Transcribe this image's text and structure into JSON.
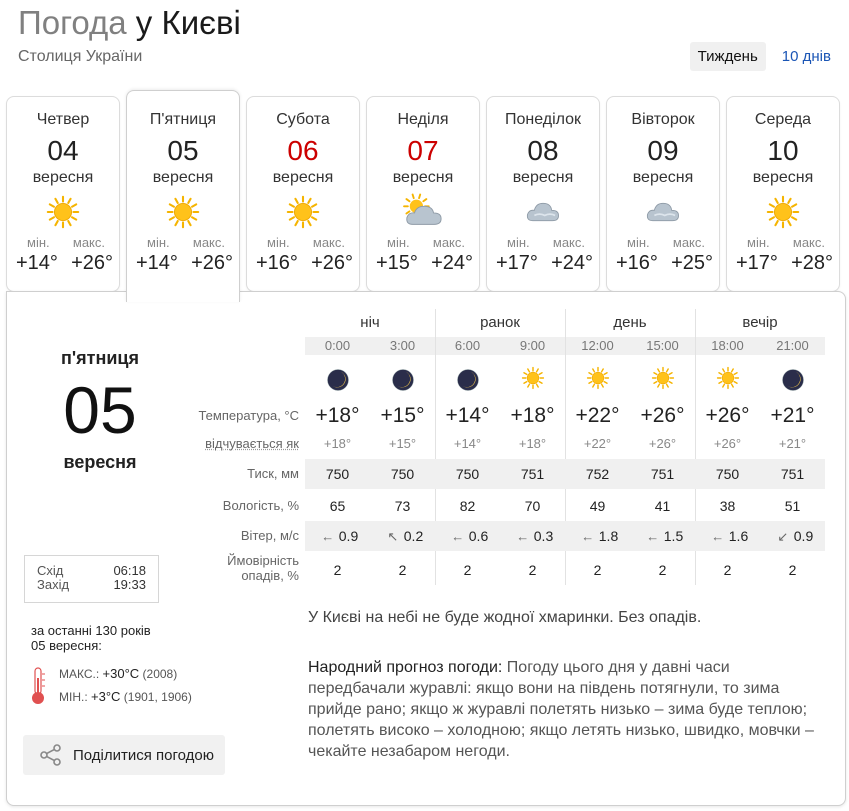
{
  "header": {
    "title_prefix": "Погода",
    "title_city": "у Києві",
    "subtitle": "Столиця України"
  },
  "period_switch": {
    "week": "Тиждень",
    "ten_days": "10 днів"
  },
  "labels": {
    "min": "мін.",
    "max": "макс."
  },
  "days": [
    {
      "name": "Четвер",
      "num": "04",
      "month": "вересня",
      "icon": "sun-icon",
      "min": "+14°",
      "max": "+26°",
      "weekend": false
    },
    {
      "name": "П'ятниця",
      "num": "05",
      "month": "вересня",
      "icon": "sun-icon",
      "min": "+14°",
      "max": "+26°",
      "weekend": false
    },
    {
      "name": "Субота",
      "num": "06",
      "month": "вересня",
      "icon": "sun-icon",
      "min": "+16°",
      "max": "+26°",
      "weekend": true
    },
    {
      "name": "Неділя",
      "num": "07",
      "month": "вересня",
      "icon": "sun-cloud-icon",
      "min": "+15°",
      "max": "+24°",
      "weekend": true
    },
    {
      "name": "Понеділок",
      "num": "08",
      "month": "вересня",
      "icon": "cloud-icon",
      "min": "+17°",
      "max": "+24°",
      "weekend": false
    },
    {
      "name": "Вівторок",
      "num": "09",
      "month": "вересня",
      "icon": "cloud-icon",
      "min": "+16°",
      "max": "+25°",
      "weekend": false
    },
    {
      "name": "Середа",
      "num": "10",
      "month": "вересня",
      "icon": "sun-icon",
      "min": "+17°",
      "max": "+28°",
      "weekend": false
    }
  ],
  "selected": {
    "day_name": "п'ятниця",
    "day_num": "05",
    "month": "вересня",
    "sunrise_label": "Схід",
    "sunrise": "06:18",
    "sunset_label": "Захід",
    "sunset": "19:33",
    "history_line1": "за останні 130 років",
    "history_line2": "05 вересня:",
    "max_label": "МАКС.:",
    "max_value": "+30°C",
    "max_years": "(2008)",
    "min_label": "МІН.:",
    "min_value": "+3°C",
    "min_years": "(1901, 1906)",
    "share": "Поділитися погодою"
  },
  "periods": [
    "ніч",
    "ранок",
    "день",
    "вечір"
  ],
  "row_labels": {
    "temperature": "Температура, °С",
    "feels": "відчувається як",
    "pressure": "Тиск, мм",
    "humidity": "Вологість, %",
    "wind": "Вітер, м/с",
    "precip": "Ймовірність опадів, %"
  },
  "hours": [
    {
      "time": "0:00",
      "icon": "moon-icon",
      "temp": "+18°",
      "feels": "+18°",
      "pressure": "750",
      "humidity": "65",
      "wind_dir": "←",
      "wind": "0.9",
      "precip": "2"
    },
    {
      "time": "3:00",
      "icon": "moon-icon",
      "temp": "+15°",
      "feels": "+15°",
      "pressure": "750",
      "humidity": "73",
      "wind_dir": "↖",
      "wind": "0.2",
      "precip": "2"
    },
    {
      "time": "6:00",
      "icon": "moon-icon",
      "temp": "+14°",
      "feels": "+14°",
      "pressure": "750",
      "humidity": "82",
      "wind_dir": "←",
      "wind": "0.6",
      "precip": "2"
    },
    {
      "time": "9:00",
      "icon": "sun-icon",
      "temp": "+18°",
      "feels": "+18°",
      "pressure": "751",
      "humidity": "70",
      "wind_dir": "←",
      "wind": "0.3",
      "precip": "2"
    },
    {
      "time": "12:00",
      "icon": "sun-icon",
      "temp": "+22°",
      "feels": "+22°",
      "pressure": "752",
      "humidity": "49",
      "wind_dir": "←",
      "wind": "1.8",
      "precip": "2"
    },
    {
      "time": "15:00",
      "icon": "sun-icon",
      "temp": "+26°",
      "feels": "+26°",
      "pressure": "751",
      "humidity": "41",
      "wind_dir": "←",
      "wind": "1.5",
      "precip": "2"
    },
    {
      "time": "18:00",
      "icon": "sun-icon",
      "temp": "+26°",
      "feels": "+26°",
      "pressure": "750",
      "humidity": "38",
      "wind_dir": "←",
      "wind": "1.6",
      "precip": "2"
    },
    {
      "time": "21:00",
      "icon": "moon-icon",
      "temp": "+21°",
      "feels": "+21°",
      "pressure": "751",
      "humidity": "51",
      "wind_dir": "↙",
      "wind": "0.9",
      "precip": "2"
    }
  ],
  "summary": "У Києві на небі не буде жодної хмаринки. Без опадів.",
  "folk_title": "Народний прогноз погоди:",
  "folk_text": "Погоду цього дня у давні часи передбачали журавлі: якщо вони на південь потягнули, то зима прийде рано; якщо ж журавлі полетять низько – зима буде теплою; полетять високо – холодною; якщо летять низько, швидко, мовчки – чекайте незабаром негоди.",
  "colors": {
    "weekend_red": "#cc0000",
    "link_blue": "#1a55b5",
    "sun": "#f5b400",
    "row_bg": "#f0f0f0"
  }
}
